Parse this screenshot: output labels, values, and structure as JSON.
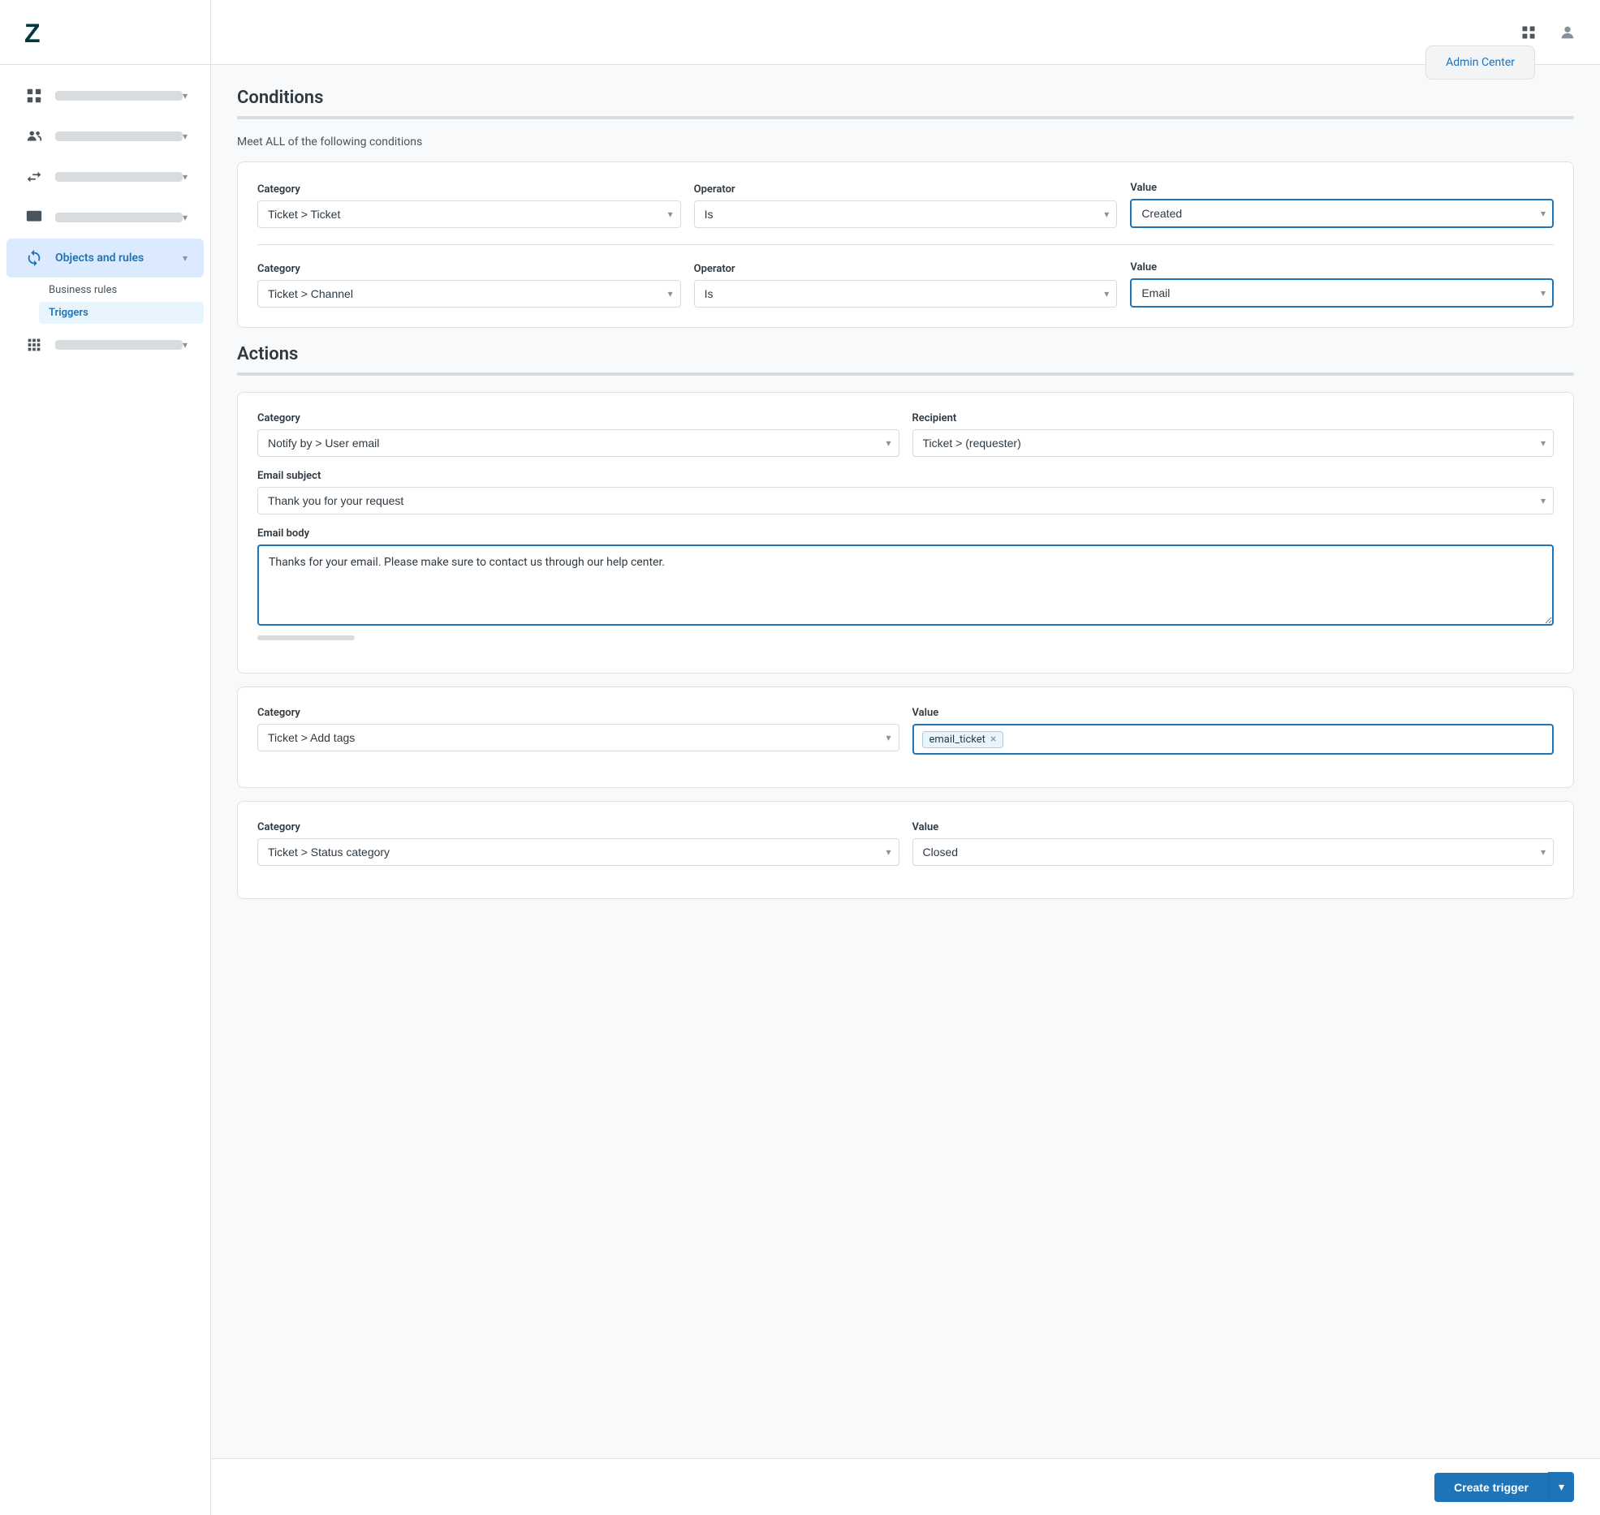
{
  "sidebar": {
    "nav_items": [
      {
        "id": "nav-building",
        "active": false,
        "has_text": false
      },
      {
        "id": "nav-people",
        "active": false,
        "has_text": false
      },
      {
        "id": "nav-arrows",
        "active": false,
        "has_text": false
      },
      {
        "id": "nav-screen",
        "active": false,
        "has_text": false
      },
      {
        "id": "nav-objects",
        "active": true,
        "label": "Objects and rules",
        "has_text": true
      },
      {
        "id": "nav-apps",
        "active": false,
        "has_text": false
      }
    ],
    "sub_items": [
      {
        "id": "sub-business-rules",
        "label": "Business rules",
        "active": false
      },
      {
        "id": "sub-triggers",
        "label": "Triggers",
        "active": true
      }
    ]
  },
  "topbar": {
    "admin_center_label": "Admin Center"
  },
  "conditions": {
    "title": "Conditions",
    "meet_label": "Meet ALL of the following conditions",
    "rows": [
      {
        "category_label": "Category",
        "category_value": "Ticket > Ticket",
        "operator_label": "Operator",
        "operator_value": "Is",
        "value_label": "Value",
        "value_value": "Created",
        "value_highlighted": true
      },
      {
        "category_label": "Category",
        "category_value": "Ticket > Channel",
        "operator_label": "Operator",
        "operator_value": "Is",
        "value_label": "Value",
        "value_value": "Email",
        "value_highlighted": true
      }
    ]
  },
  "actions": {
    "title": "Actions",
    "rows": [
      {
        "category_label": "Category",
        "category_value": "Notify by > User email",
        "recipient_label": "Recipient",
        "recipient_value": "Ticket > (requester)"
      }
    ],
    "email_subject_label": "Email subject",
    "email_subject_value": "Thank you for your request",
    "email_body_label": "Email body",
    "email_body_value": "Thanks for your email. Please make sure to contact us through our help center.",
    "add_tags_row": {
      "category_label": "Category",
      "category_value": "Ticket > Add tags",
      "value_label": "Value",
      "tag": "email_ticket"
    },
    "status_row": {
      "category_label": "Category",
      "category_value": "Ticket > Status category",
      "value_label": "Value",
      "value_value": "Closed"
    }
  },
  "bottom_bar": {
    "create_button_label": "Create trigger"
  }
}
